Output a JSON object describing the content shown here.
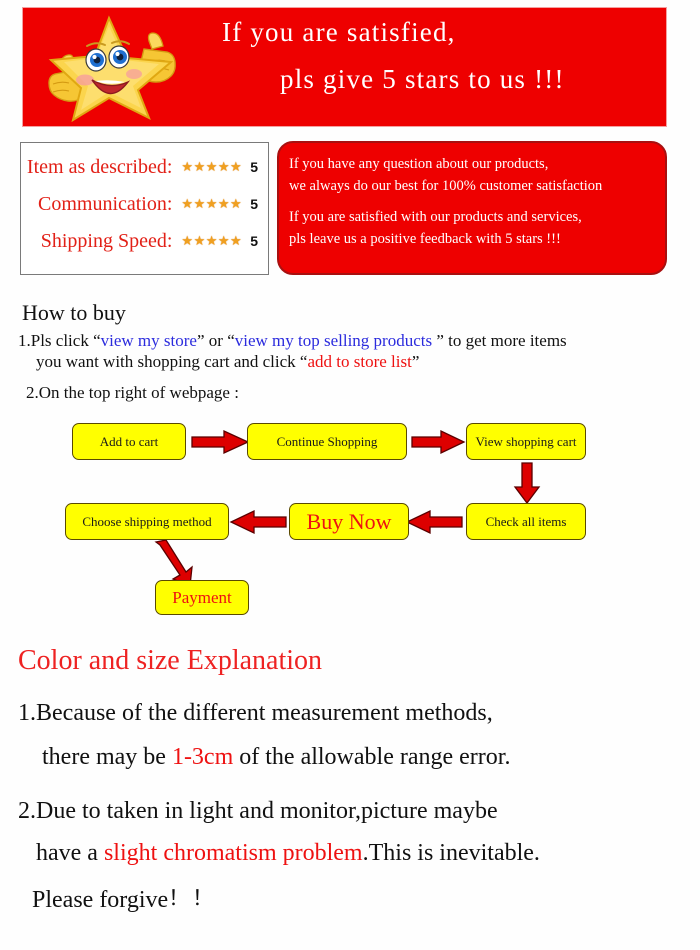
{
  "banner": {
    "line1": "If you are satisfied,",
    "line2": "pls give 5 stars to us !!!",
    "bg_color": "#ee0000",
    "text_color": "#ffffff",
    "mascot_icon": "smiling-star-thumbs-up-icon"
  },
  "ratings": {
    "rows": [
      {
        "label": "Item as described:",
        "stars": "★★★★★",
        "score": "5"
      },
      {
        "label": "Communication:",
        "stars": "★★★★★",
        "score": "5"
      },
      {
        "label": "Shipping Speed:",
        "stars": "★★★★★",
        "score": "5"
      }
    ],
    "label_color": "#e22017",
    "star_color": "#f0a020"
  },
  "feedback": {
    "line1": "If you have any question about our products,",
    "line2": "we always do our best for 100% customer satisfaction",
    "line3": "If you are satisfied with our products and services,",
    "line4": "pls leave us a positive feedback with 5 stars !!!",
    "bg_color": "#ee0000"
  },
  "how_to_buy": {
    "title": "How to buy",
    "item1": {
      "prefix": "1.Pls click ",
      "q1_open": "“",
      "link1": "view my store",
      "q1_close": "”",
      "mid": " or ",
      "q2_open": "“",
      "link2": "view my top selling products",
      "q2_close": " ”",
      "suffix": " to get more items",
      "line2_prefix": "you want with shopping cart and click ",
      "q3_open": "“",
      "link3": "add to store list",
      "q3_close": "”"
    },
    "item2": "2.On the top right of webpage :",
    "link_color": "#2b2bdd",
    "highlight_color": "#ee1111"
  },
  "flowchart": {
    "boxes": [
      {
        "id": "add-to-cart",
        "label": "Add to cart"
      },
      {
        "id": "continue-shopping",
        "label": "Continue Shopping"
      },
      {
        "id": "view-shopping-cart",
        "label": "View shopping cart"
      },
      {
        "id": "check-all-items",
        "label": "Check all items"
      },
      {
        "id": "buy-now",
        "label": "Buy Now"
      },
      {
        "id": "choose-shipping-method",
        "label": "Choose shipping method"
      },
      {
        "id": "payment",
        "label": "Payment"
      }
    ],
    "box_color": "#ffff00",
    "arrow_color": "#dd0000"
  },
  "explanation": {
    "title": "Color and size Explanation",
    "item1_line1": "1.Because of the different measurement methods,",
    "item1_line2_a": "there may be ",
    "item1_highlight": "1-3cm",
    "item1_line2_b": " of the allowable range error.",
    "item2_line1": "2.Due to taken in light and monitor,picture maybe",
    "item2_line2_a": "have a ",
    "item2_highlight": "slight chromatism problem",
    "item2_line2_b": ".This is inevitable.",
    "item2_line3": "Please forgive",
    "item2_bangs": "！！",
    "title_color": "#ee2222",
    "highlight_color": "#ee1111"
  }
}
